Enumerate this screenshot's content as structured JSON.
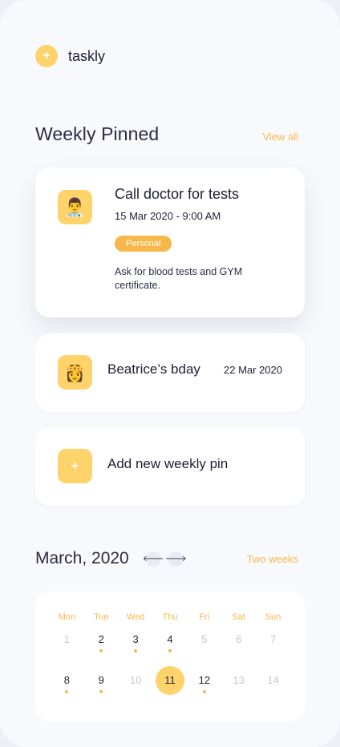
{
  "app": {
    "name": "taskly",
    "logo_glyph": "+"
  },
  "weekly": {
    "title": "Weekly Pinned",
    "view_all": "View all",
    "pins": [
      {
        "emoji": "👨‍⚕️",
        "title": "Call doctor for tests",
        "datetime": "15 Mar 2020 - 9:00 AM",
        "tag": "Personal",
        "description": "Ask for blood tests and GYM certificate."
      },
      {
        "emoji": "👸",
        "title": "Beatrice’s bday",
        "date": "22 Mar 2020"
      }
    ],
    "add": {
      "glyph": "+",
      "label": "Add new weekly pin"
    }
  },
  "calendar": {
    "month": "March, 2020",
    "prev_glyph": "🡐",
    "next_glyph": "🡒",
    "range_link": "Two weeks",
    "weekdays": [
      "Mon",
      "Tue",
      "Wed",
      "Thu",
      "Fri",
      "Sat",
      "Sun"
    ],
    "days": [
      {
        "n": "1",
        "muted": true,
        "dot": false,
        "selected": false
      },
      {
        "n": "2",
        "muted": false,
        "dot": true,
        "selected": false
      },
      {
        "n": "3",
        "muted": false,
        "dot": true,
        "selected": false
      },
      {
        "n": "4",
        "muted": false,
        "dot": true,
        "selected": false
      },
      {
        "n": "5",
        "muted": true,
        "dot": false,
        "selected": false
      },
      {
        "n": "6",
        "muted": true,
        "dot": false,
        "selected": false
      },
      {
        "n": "7",
        "muted": true,
        "dot": false,
        "selected": false
      },
      {
        "n": "8",
        "muted": false,
        "dot": true,
        "selected": false
      },
      {
        "n": "9",
        "muted": false,
        "dot": true,
        "selected": false
      },
      {
        "n": "10",
        "muted": true,
        "dot": false,
        "selected": false
      },
      {
        "n": "11",
        "muted": false,
        "dot": false,
        "selected": true
      },
      {
        "n": "12",
        "muted": false,
        "dot": true,
        "selected": false
      },
      {
        "n": "13",
        "muted": true,
        "dot": false,
        "selected": false
      },
      {
        "n": "14",
        "muted": true,
        "dot": false,
        "selected": false
      }
    ]
  },
  "colors": {
    "accent": "#f7b84b",
    "tile": "#ffd36b",
    "background": "#f8f9fc"
  }
}
